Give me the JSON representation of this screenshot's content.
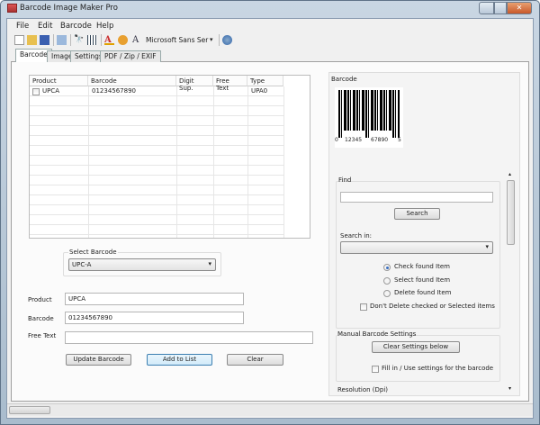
{
  "window": {
    "title": "Barcode Image Maker Pro"
  },
  "menu": [
    "File",
    "Edit",
    "Barcode",
    "Help"
  ],
  "toolbar": {
    "font_name": "Microsoft Sans Ser"
  },
  "tabs": [
    "Barcode",
    "Image",
    "Settings",
    "PDF / Zip / EXIF"
  ],
  "grid": {
    "columns": [
      "Product",
      "Barcode",
      "Digit Sup.",
      "Free Text",
      "Type"
    ],
    "rows": [
      {
        "product": "UPCA",
        "barcode": "01234567890",
        "digit_sup": "",
        "free_text": "",
        "type": "UPA0",
        "checked": false
      }
    ]
  },
  "select_barcode": {
    "label": "Select Barcode",
    "value": "UPC-A"
  },
  "form": {
    "product_label": "Product",
    "product_value": "UPCA",
    "barcode_label": "Barcode",
    "barcode_value": "01234567890",
    "free_text_label": "Free Text",
    "free_text_value": ""
  },
  "buttons": {
    "update": "Update Barcode",
    "add": "Add to List",
    "clear": "Clear"
  },
  "preview": {
    "label": "Barcode",
    "digits_left": "0",
    "digits_mid1": "12345",
    "digits_mid2": "67890",
    "digits_right": "5"
  },
  "find": {
    "label": "Find",
    "search_value": "",
    "search_button": "Search",
    "search_in_label": "Search in:",
    "search_in_value": "",
    "options": [
      {
        "label": "Check found Item",
        "selected": true
      },
      {
        "label": "Select found Item",
        "selected": false
      },
      {
        "label": "Delete found Item",
        "selected": false
      }
    ],
    "dont_delete_label": "Don't Delete checked or Selected items"
  },
  "manual": {
    "label": "Manual Barcode Settings",
    "clear_button": "Clear Settings below",
    "fill_label": "Fill in / Use settings for the barcode"
  },
  "resolution": {
    "label": "Resolution (Dpi)"
  }
}
